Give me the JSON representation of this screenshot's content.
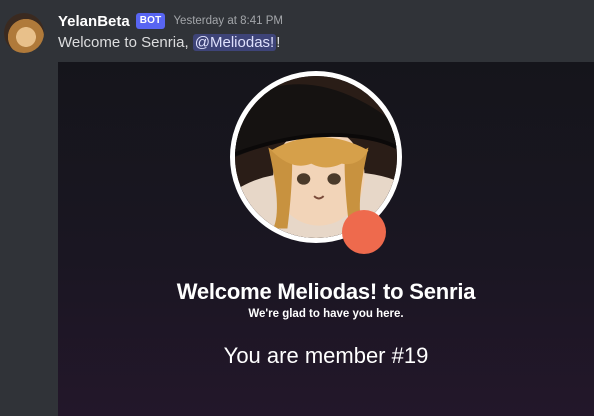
{
  "message": {
    "author": "YelanBeta",
    "badge": "BOT",
    "timestamp": "Yesterday at 8:41 PM",
    "text_before": "Welcome to Senria, ",
    "mention": "@Meliodas!",
    "text_after": "!"
  },
  "card": {
    "title": "Welcome Meliodas! to Senria",
    "subtitle": "We're glad to have you here.",
    "member_text": "You are member #19"
  },
  "colors": {
    "bot_badge": "#5865f2",
    "mention_bg": "#3b4270",
    "status_dot": "#ee6a4d"
  }
}
